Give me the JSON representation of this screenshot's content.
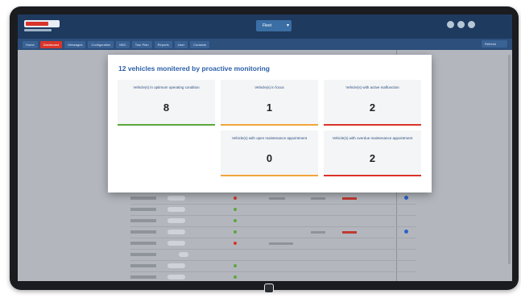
{
  "colors": {
    "optimum": "#5aa83c",
    "focus": "#f2a53a",
    "malfunction": "#d9342b",
    "open_maintenance": "#f2a53a",
    "overdue_maintenance": "#d9342b"
  },
  "header": {
    "logo_text": "SCHMITZ CARGOBULL",
    "fleet_select": "Fleet"
  },
  "nav": {
    "tabs": [
      {
        "label": "Home",
        "icon": "home-icon"
      },
      {
        "label": "Dashboard",
        "icon": "dashboard-icon",
        "active": true
      },
      {
        "label": "Messages",
        "icon": "messages-icon"
      },
      {
        "label": "Configuration",
        "icon": "gear-icon"
      },
      {
        "label": "NBC",
        "icon": "truck-icon"
      },
      {
        "label": "Tour Plan",
        "icon": "route-icon"
      },
      {
        "label": "Reports",
        "icon": "report-icon"
      },
      {
        "label": "User",
        "icon": "user-icon"
      },
      {
        "label": "Contacts",
        "icon": "contacts-icon"
      }
    ],
    "right_button": "Refresh"
  },
  "modal": {
    "title": "12 vehicles monitered by proactive monitoring",
    "cards": [
      {
        "label": "Vehicle(s) in optimum operating condition",
        "value": "8",
        "status": "optimum"
      },
      {
        "label": "Vehicle(s) in focus",
        "value": "1",
        "status": "focus"
      },
      {
        "label": "Vehicle(s) with active malfunction",
        "value": "2",
        "status": "malfunction"
      },
      {
        "label": "Vehicle(s) with open maintenance appointment",
        "value": "0",
        "status": "open_maintenance"
      },
      {
        "label": "Vehicle(s) with overdue maintenance appointment",
        "value": "2",
        "status": "overdue_maintenance"
      }
    ]
  }
}
